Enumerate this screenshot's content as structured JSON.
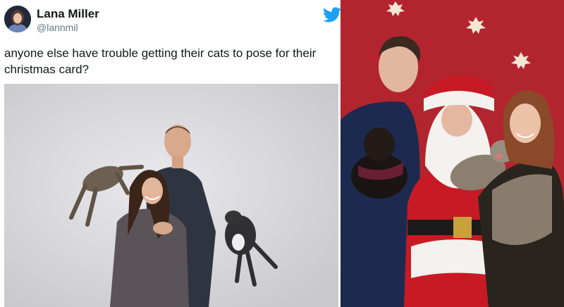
{
  "tweet": {
    "author_name": "Lana Miller",
    "author_handle": "@lannmil",
    "text": "anyone else have trouble getting their cats to pose for their christmas card?",
    "icons": {
      "avatar": "avatar",
      "platform": "twitter-bird-icon"
    }
  },
  "colors": {
    "text": "#14171a",
    "handle": "#657786",
    "brand": "#1da1f2",
    "backdrop_left": "#d9d8dc",
    "backdrop_right": "#b3252e"
  }
}
